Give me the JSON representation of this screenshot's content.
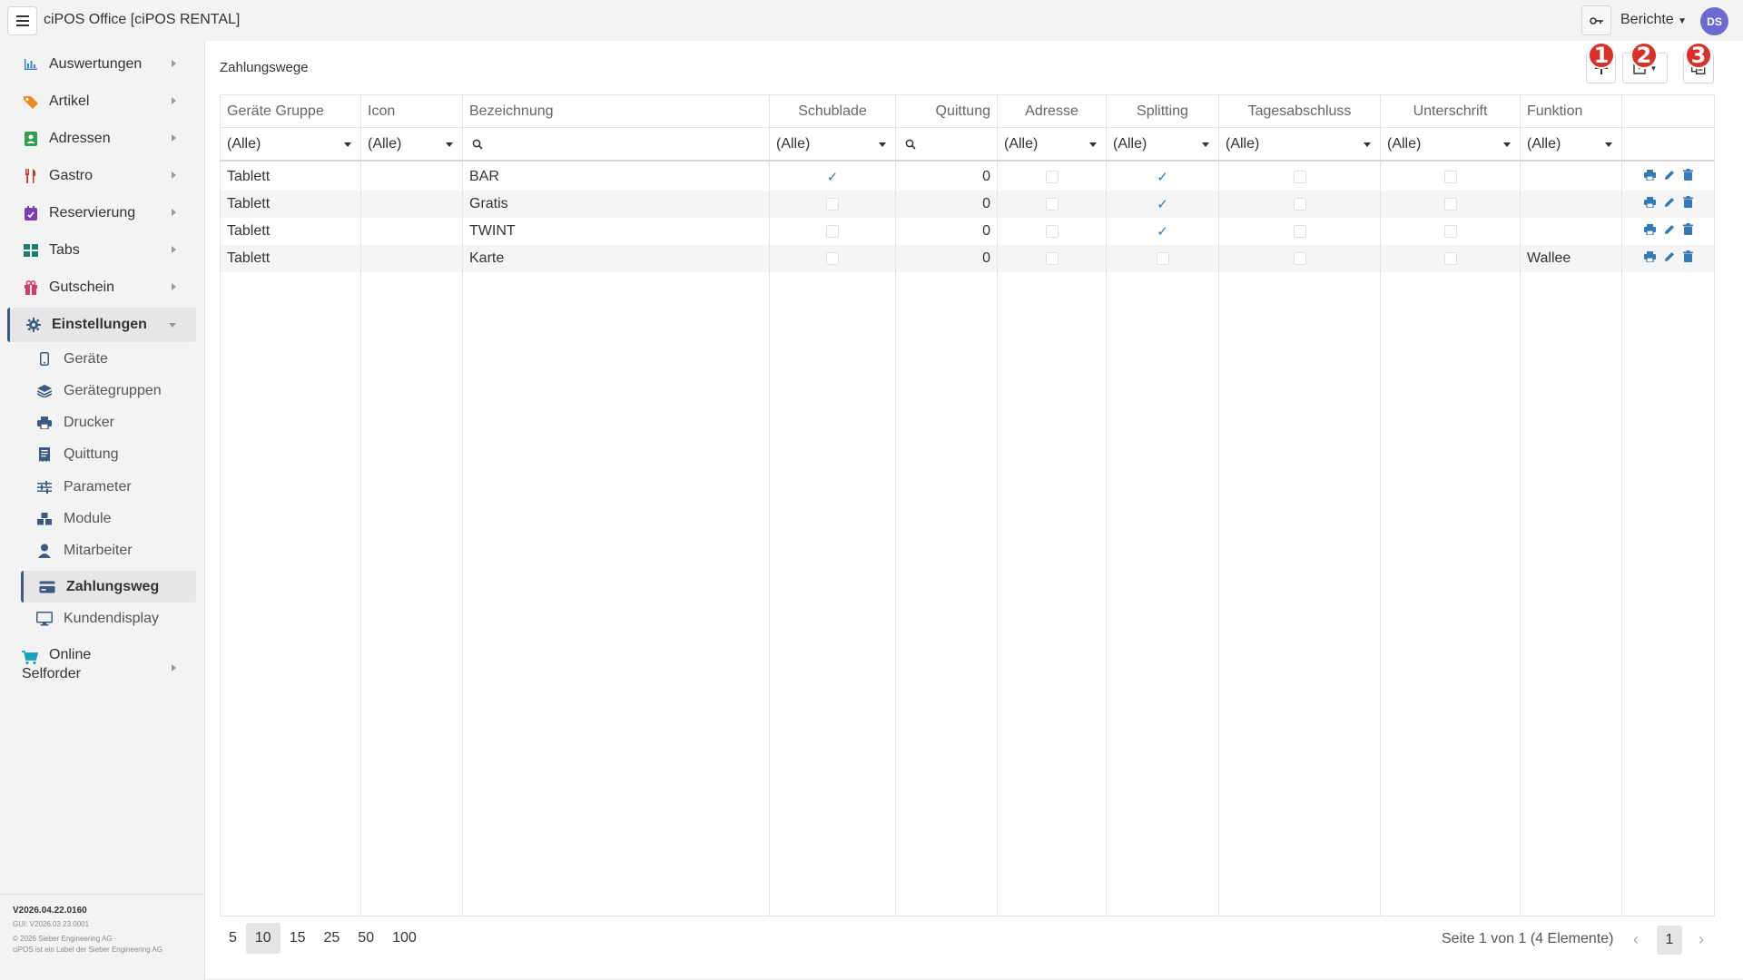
{
  "app": {
    "title": "ciPOS Office [ciPOS RENTAL]",
    "reports_label": "Berichte",
    "avatar_initials": "DS"
  },
  "sidebar": {
    "items": [
      {
        "label": "Auswertungen",
        "icon": "chart-icon",
        "color": "#3d7fd6"
      },
      {
        "label": "Artikel",
        "icon": "tag-icon",
        "color": "#f08a24"
      },
      {
        "label": "Adressen",
        "icon": "contact-icon",
        "color": "#2e9e4f"
      },
      {
        "label": "Gastro",
        "icon": "cutlery-icon",
        "color": "#c0392b"
      },
      {
        "label": "Reservierung",
        "icon": "calendar-icon",
        "color": "#7b3fb5"
      },
      {
        "label": "Tabs",
        "icon": "grid-icon",
        "color": "#17806d"
      },
      {
        "label": "Gutschein",
        "icon": "gift-icon",
        "color": "#d63a6b"
      },
      {
        "label": "Einstellungen",
        "icon": "gear-icon",
        "color": "#3d5a80"
      }
    ],
    "sub_items": [
      {
        "label": "Geräte",
        "icon": "phone-icon"
      },
      {
        "label": "Gerätegruppen",
        "icon": "layers-icon"
      },
      {
        "label": "Drucker",
        "icon": "printer-icon"
      },
      {
        "label": "Quittung",
        "icon": "receipt-icon"
      },
      {
        "label": "Parameter",
        "icon": "sliders-icon"
      },
      {
        "label": "Module",
        "icon": "cubes-icon"
      },
      {
        "label": "Mitarbeiter",
        "icon": "user-icon"
      },
      {
        "label": "Zahlungsweg",
        "icon": "credit-card-icon"
      },
      {
        "label": "Kundendisplay",
        "icon": "monitor-icon"
      }
    ],
    "online": {
      "line1": "Online",
      "line2": "Selforder",
      "icon": "cart-icon",
      "color": "#17a2b8"
    },
    "footer": {
      "version": "V2026.04.22.0160",
      "gui": "GUI: V2026.03.23.0001",
      "copyright": "© 2026 Sieber Engineering AG ·",
      "label": "ciPOS ist ein Label der Sieber Engineering AG"
    }
  },
  "main": {
    "title": "Zahlungswege",
    "badges": [
      "1",
      "2",
      "3"
    ],
    "columns": [
      "Geräte Gruppe",
      "Icon",
      "Bezeichnung",
      "Schublade",
      "Quittung",
      "Adresse",
      "Splitting",
      "Tagesabschluss",
      "Unterschrift",
      "Funktion"
    ],
    "filters": {
      "geraete_gruppe": "(Alle)",
      "icon": "(Alle)",
      "schublade": "(Alle)",
      "adresse": "(Alle)",
      "splitting": "(Alle)",
      "tagesabschluss": "(Alle)",
      "unterschrift": "(Alle)",
      "funktion": "(Alle)"
    },
    "rows": [
      {
        "gruppe": "Tablett",
        "bezeichnung": "BAR",
        "schublade": true,
        "quittung": "0",
        "adresse": false,
        "splitting": true,
        "tagesabschluss": false,
        "unterschrift": false,
        "funktion": ""
      },
      {
        "gruppe": "Tablett",
        "bezeichnung": "Gratis",
        "schublade": false,
        "quittung": "0",
        "adresse": false,
        "splitting": true,
        "tagesabschluss": false,
        "unterschrift": false,
        "funktion": ""
      },
      {
        "gruppe": "Tablett",
        "bezeichnung": "TWINT",
        "schublade": false,
        "quittung": "0",
        "adresse": false,
        "splitting": true,
        "tagesabschluss": false,
        "unterschrift": false,
        "funktion": ""
      },
      {
        "gruppe": "Tablett",
        "bezeichnung": "Karte",
        "schublade": false,
        "quittung": "0",
        "adresse": false,
        "splitting": false,
        "tagesabschluss": false,
        "unterschrift": false,
        "funktion": "Wallee"
      }
    ],
    "page_sizes": [
      "5",
      "10",
      "15",
      "25",
      "50",
      "100"
    ],
    "selected_page_size": "10",
    "pager_info": "Seite 1 von 1 (4 Elemente)",
    "current_page": "1"
  }
}
